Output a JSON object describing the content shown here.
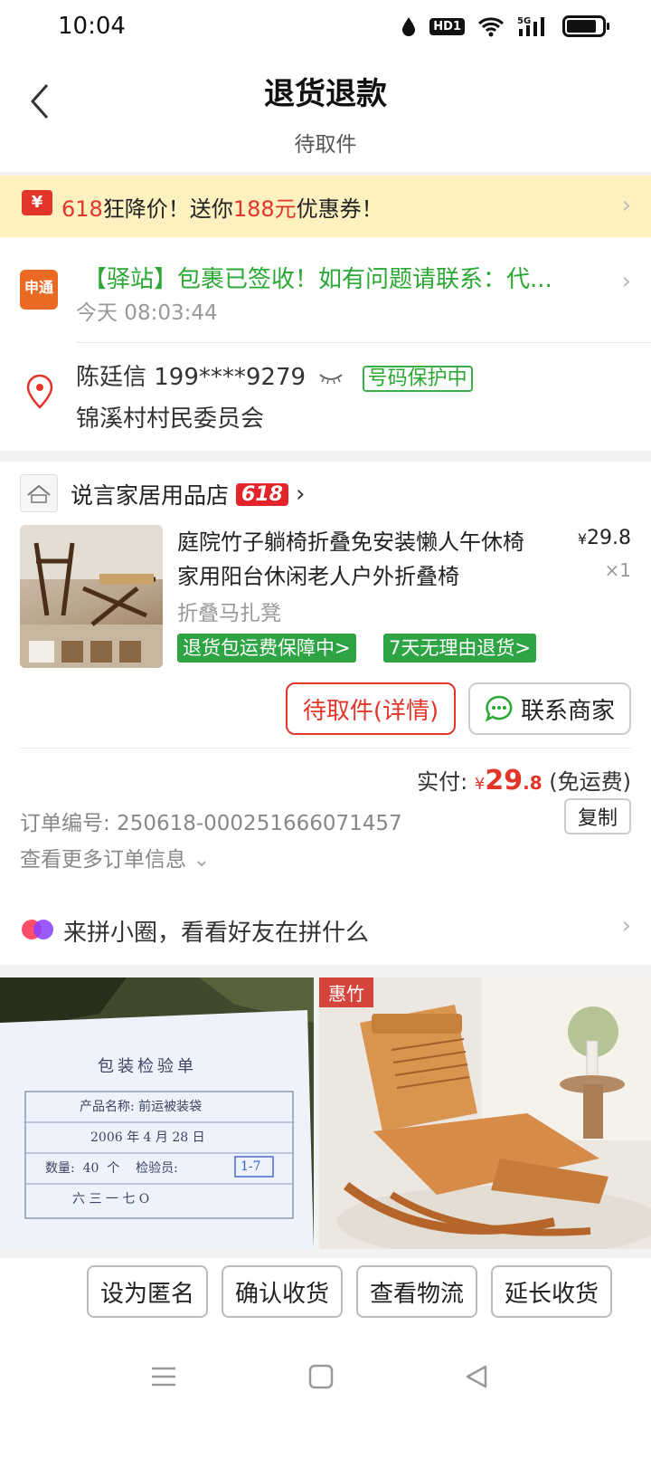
{
  "status_bar": {
    "time": "10:04",
    "hd": "HD1",
    "net": "5G"
  },
  "header": {
    "title": "退货退款",
    "subtitle": "待取件"
  },
  "promo": {
    "icon": "¥",
    "part1": "618",
    "part2": "狂降价！送你",
    "part3": "188元",
    "part4": "优惠券！"
  },
  "logistics": {
    "carrier_logo": "申通",
    "message": "【驿站】包裹已签收！如有问题请联系：代...",
    "time": "今天 08:03:44",
    "receiver": "陈廷信  199****9279",
    "protect_label": "号码保护中",
    "address": "锦溪村村民委员会"
  },
  "order": {
    "shop_name": "说言家居用品店",
    "shop_badge": "618",
    "product_title": "庭院竹子躺椅折叠免安装懒人午休椅家用阳台休闲老人户外折叠椅",
    "price_symbol": "¥",
    "price": "29.8",
    "qty": "×1",
    "spec": "折叠马扎凳",
    "tags": [
      "退货包运费保障中>",
      "7天无理由退货>"
    ],
    "btn_pickup": "待取件(详情)",
    "btn_contact": "联系商家",
    "paid_label": "实付:",
    "paid_symbol": "¥",
    "paid_amount": "29",
    "paid_decimal": ".8",
    "paid_note": "(免运费)",
    "order_no": "订单编号: 250618-000251666071457",
    "copy_label": "复制",
    "more_info": "查看更多订单信息"
  },
  "group": {
    "text": "来拼小圈，看看好友在拼什么"
  },
  "images": {
    "left": {
      "title": "包装检验单",
      "line1": "产品名称: 前运被装袋",
      "line2": "2006 年 4 月 28 日",
      "line3": "数量:  40  个    检验员:",
      "inspector": "1-7",
      "line4": "六 三 一 七 O"
    },
    "right": {
      "tag": "惠竹"
    }
  },
  "actions": [
    "设为匿名",
    "确认收货",
    "查看物流",
    "延长收货"
  ]
}
